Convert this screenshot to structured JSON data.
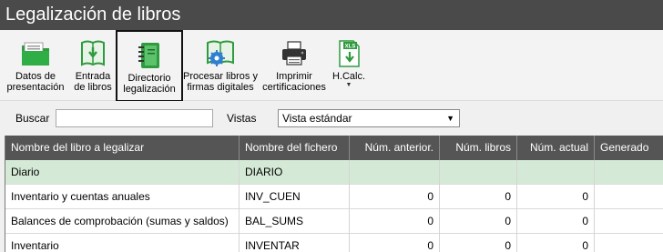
{
  "window": {
    "title": "Legalización de libros"
  },
  "ribbon": {
    "buttons": [
      {
        "label": "Datos de\npresentación",
        "icon": "folder-icon"
      },
      {
        "label": "Entrada\nde libros",
        "icon": "book-download-icon"
      },
      {
        "label": "Directorio\nlegalización",
        "icon": "binder-icon",
        "selected": true
      },
      {
        "label": "Procesar libros y\nfirmas digitales",
        "icon": "book-gear-icon"
      },
      {
        "label": "Imprimir\ncertificaciones",
        "icon": "printer-icon"
      },
      {
        "label": "H.Calc.",
        "icon": "spreadsheet-icon",
        "badge": "XLS",
        "dropdown": true
      }
    ]
  },
  "filter": {
    "search_label": "Buscar",
    "search_value": "",
    "vistas_label": "Vistas",
    "vistas_value": "Vista estándar"
  },
  "table": {
    "columns": [
      "Nombre del libro a legalizar",
      "Nombre del fichero",
      "Núm. anterior.",
      "Núm. libros",
      "Núm. actual",
      "Generado"
    ],
    "rows": [
      {
        "name": "Diario",
        "file": "DIARIO",
        "prev": "",
        "books": "",
        "current": "",
        "generated": "",
        "selected": true
      },
      {
        "name": "Inventario y cuentas anuales",
        "file": "INV_CUEN",
        "prev": "0",
        "books": "0",
        "current": "0",
        "generated": ""
      },
      {
        "name": "Balances de comprobación (sumas y saldos)",
        "file": "BAL_SUMS",
        "prev": "0",
        "books": "0",
        "current": "0",
        "generated": ""
      },
      {
        "name": "Inventario",
        "file": "INVENTAR",
        "prev": "0",
        "books": "0",
        "current": "0",
        "generated": ""
      }
    ]
  },
  "colors": {
    "titlebar": "#4a4a4a",
    "header": "#555555",
    "selected_row": "#d5ead6",
    "accent_green": "#2e9b3e",
    "accent_blue": "#2f7fd1"
  }
}
